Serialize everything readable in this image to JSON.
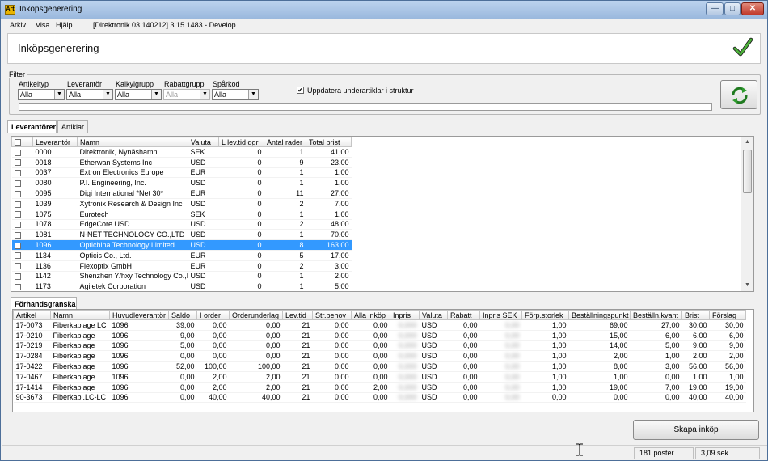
{
  "window": {
    "app_icon": "Art",
    "title": "Inköpsgenerering",
    "buttons": {
      "minimize": "—",
      "maximize": "□",
      "close": "✕"
    }
  },
  "menu": {
    "items": [
      "Arkiv",
      "Visa",
      "Hjälp"
    ],
    "context": "[Direktronik 03 140212] 3.15.1483 - Develop"
  },
  "header": {
    "title": "Inköpsgenerering",
    "confirm_icon": "checkmark-icon"
  },
  "filter": {
    "legend": "Filter",
    "fields": [
      {
        "label": "Artikeltyp",
        "value": "Alla"
      },
      {
        "label": "Leverantör",
        "value": "Alla"
      },
      {
        "label": "Kalkylgrupp",
        "value": "Alla"
      },
      {
        "label": "Rabattgrupp",
        "value": "Alla"
      },
      {
        "label": "Spårkod",
        "value": "Alla"
      }
    ],
    "update_checkbox": {
      "label": "Uppdatera underartiklar i struktur",
      "checked": "✔"
    },
    "refresh_icon": "refresh-icon"
  },
  "tabs": [
    "Leverantörer",
    "Artiklar"
  ],
  "suppliers": {
    "columns": [
      "",
      "Leverantör",
      "Namn",
      "Valuta",
      "L lev.tid dgr",
      "Antal rader",
      "Total brist"
    ],
    "rows": [
      [
        "0000",
        "Direktronik, Nynäshamn",
        "SEK",
        "0",
        "1",
        "41,00"
      ],
      [
        "0018",
        "Etherwan Systems Inc",
        "USD",
        "0",
        "9",
        "23,00"
      ],
      [
        "0037",
        "Extron Electronics Europe",
        "EUR",
        "0",
        "1",
        "1,00"
      ],
      [
        "0080",
        "P.I. Engineering, Inc.",
        "USD",
        "0",
        "1",
        "1,00"
      ],
      [
        "0095",
        "Digi International *Net 30*",
        "EUR",
        "0",
        "11",
        "27,00"
      ],
      [
        "1039",
        "Xytronix Research & Design Inc",
        "USD",
        "0",
        "2",
        "7,00"
      ],
      [
        "1075",
        "Eurotech",
        "SEK",
        "0",
        "1",
        "1,00"
      ],
      [
        "1078",
        "EdgeCore USD",
        "USD",
        "0",
        "2",
        "48,00"
      ],
      [
        "1081",
        "N-NET TECHNOLOGY CO.,LTD",
        "USD",
        "0",
        "1",
        "70,00"
      ],
      [
        "1096",
        "Optichina Technology Limited",
        "USD",
        "0",
        "8",
        "163,00"
      ],
      [
        "1134",
        "Opticis Co., Ltd.",
        "EUR",
        "0",
        "5",
        "17,00"
      ],
      [
        "1136",
        "Flexoptix GmbH",
        "EUR",
        "0",
        "2",
        "3,00"
      ],
      [
        "1142",
        "Shenzhen Y/hxy Technology Co.,L",
        "USD",
        "0",
        "1",
        "2,00"
      ],
      [
        "1173",
        "Agiletek Corporation",
        "USD",
        "0",
        "1",
        "5,00"
      ]
    ],
    "selected_supplier": "1096"
  },
  "preview": {
    "tab": "Förhandsgranska",
    "columns": [
      "Artikel",
      "Namn",
      "Huvudleverantör",
      "Saldo",
      "I order",
      "Orderunderlag",
      "Lev.tid",
      "Str.behov",
      "Alla inköp",
      "Inpris",
      "Valuta",
      "Rabatt",
      "Inpris SEK",
      "Förp.storlek",
      "Beställningspunkt",
      "Beställn.kvant",
      "Brist",
      "Förslag"
    ],
    "rows": [
      [
        "17-0073",
        "Fiberkablage LC",
        "1096",
        "39,00",
        "0,00",
        "0,00",
        "21",
        "0,00",
        "0,00",
        "0,000",
        "USD",
        "0,00",
        "0,00",
        "1,00",
        "69,00",
        "27,00",
        "30,00",
        "30,00"
      ],
      [
        "17-0210",
        "Fiberkablage",
        "1096",
        "9,00",
        "0,00",
        "0,00",
        "21",
        "0,00",
        "0,00",
        "0,000",
        "USD",
        "0,00",
        "0,00",
        "1,00",
        "15,00",
        "6,00",
        "6,00",
        "6,00"
      ],
      [
        "17-0219",
        "Fiberkablage",
        "1096",
        "5,00",
        "0,00",
        "0,00",
        "21",
        "0,00",
        "0,00",
        "0,000",
        "USD",
        "0,00",
        "0,00",
        "1,00",
        "14,00",
        "5,00",
        "9,00",
        "9,00"
      ],
      [
        "17-0284",
        "Fiberkablage",
        "1096",
        "0,00",
        "0,00",
        "0,00",
        "21",
        "0,00",
        "0,00",
        "0,000",
        "USD",
        "0,00",
        "0,00",
        "1,00",
        "2,00",
        "1,00",
        "2,00",
        "2,00"
      ],
      [
        "17-0422",
        "Fiberkablage",
        "1096",
        "52,00",
        "100,00",
        "100,00",
        "21",
        "0,00",
        "0,00",
        "0,000",
        "USD",
        "0,00",
        "0,00",
        "1,00",
        "8,00",
        "3,00",
        "56,00",
        "56,00"
      ],
      [
        "17-0467",
        "Fiberkablage",
        "1096",
        "0,00",
        "2,00",
        "2,00",
        "21",
        "0,00",
        "0,00",
        "0,000",
        "USD",
        "0,00",
        "0,00",
        "1,00",
        "1,00",
        "0,00",
        "1,00",
        "1,00"
      ],
      [
        "17-1414",
        "Fiberkablage",
        "1096",
        "0,00",
        "2,00",
        "2,00",
        "21",
        "0,00",
        "2,00",
        "0,000",
        "USD",
        "0,00",
        "0,00",
        "1,00",
        "19,00",
        "7,00",
        "19,00",
        "19,00"
      ],
      [
        "90-3673",
        "Fiberkabl.LC-LC",
        "1096",
        "0,00",
        "40,00",
        "40,00",
        "21",
        "0,00",
        "0,00",
        "0,000",
        "USD",
        "0,00",
        "0,00",
        "0,00",
        "0,00",
        "0,00",
        "40,00",
        "40,00"
      ]
    ]
  },
  "actions": {
    "create_purchase": "Skapa inköp"
  },
  "status": {
    "records": "181 poster",
    "time": "3,09 sek"
  }
}
